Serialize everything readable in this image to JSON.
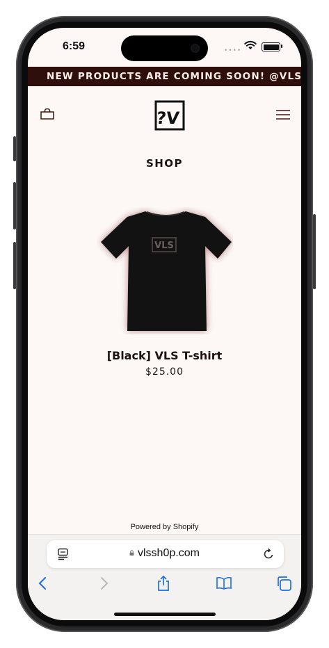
{
  "status_bar": {
    "time": "6:59"
  },
  "announcement": {
    "text": "NEW PRODUCTS ARE COMING SOON!   @VLSF"
  },
  "header": {
    "logo_text": "VLS"
  },
  "page": {
    "title": "SHOP"
  },
  "product": {
    "name": "[Black] VLS T-shirt",
    "price": "$25.00",
    "shirt_color": "#121212",
    "shirt_print": "VLS"
  },
  "footer": {
    "powered_by": "Powered by Shopify"
  },
  "browser": {
    "url": "vlssh0p.com"
  },
  "colors": {
    "banner_bg": "#2e0f0c",
    "page_bg": "#fdf8f6",
    "accent_icon": "#1b6fe0"
  }
}
